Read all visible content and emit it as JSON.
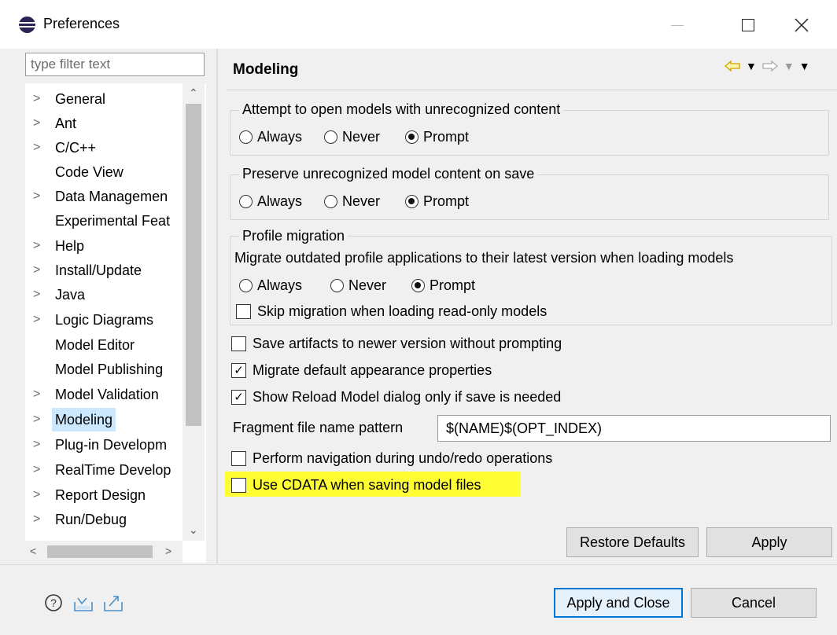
{
  "window": {
    "title": "Preferences",
    "controls": [
      "minimize",
      "maximize",
      "close"
    ]
  },
  "sidebar": {
    "filter_placeholder": "type filter text",
    "items": [
      {
        "label": "General",
        "expandable": true
      },
      {
        "label": "Ant",
        "expandable": true
      },
      {
        "label": "C/C++",
        "expandable": true
      },
      {
        "label": "Code View",
        "expandable": false
      },
      {
        "label": "Data Managemen",
        "expandable": true
      },
      {
        "label": "Experimental Feat",
        "expandable": false
      },
      {
        "label": "Help",
        "expandable": true
      },
      {
        "label": "Install/Update",
        "expandable": true
      },
      {
        "label": "Java",
        "expandable": true
      },
      {
        "label": "Logic Diagrams",
        "expandable": true
      },
      {
        "label": "Model Editor",
        "expandable": false
      },
      {
        "label": "Model Publishing",
        "expandable": false
      },
      {
        "label": "Model Validation",
        "expandable": true
      },
      {
        "label": "Modeling",
        "expandable": true,
        "selected": true
      },
      {
        "label": "Plug-in Developm",
        "expandable": true
      },
      {
        "label": "RealTime Develop",
        "expandable": true
      },
      {
        "label": "Report Design",
        "expandable": true
      },
      {
        "label": "Run/Debug",
        "expandable": true
      }
    ]
  },
  "main": {
    "title": "Modeling",
    "nav_icons": [
      "back-arrow-icon",
      "back-menu-icon",
      "forward-arrow-icon",
      "forward-menu-icon",
      "view-menu-icon"
    ],
    "group_open": {
      "title": "Attempt to open models with unrecognized content",
      "options": [
        "Always",
        "Never",
        "Prompt"
      ],
      "selected": "Prompt"
    },
    "group_preserve": {
      "title": "Preserve unrecognized model content on save",
      "options": [
        "Always",
        "Never",
        "Prompt"
      ],
      "selected": "Prompt"
    },
    "group_profile": {
      "title": "Profile migration",
      "description": "Migrate outdated profile applications to their latest version when loading models",
      "options": [
        "Always",
        "Never",
        "Prompt"
      ],
      "selected": "Prompt",
      "skip_label": "Skip migration when loading read-only models",
      "skip_checked": false
    },
    "checks": [
      {
        "label": "Save artifacts to newer version without prompting",
        "checked": false
      },
      {
        "label": "Migrate default appearance properties",
        "checked": true
      },
      {
        "label": "Show Reload Model dialog only if save is needed",
        "checked": true
      }
    ],
    "fragment": {
      "label": "Fragment file name pattern",
      "value": "$(NAME)$(OPT_INDEX)"
    },
    "checks2": [
      {
        "label": "Perform navigation during undo/redo operations",
        "checked": false
      },
      {
        "label": "Use CDATA when saving model files",
        "checked": false,
        "highlighted": true
      }
    ],
    "restore_label": "Restore Defaults",
    "apply_label": "Apply"
  },
  "footer": {
    "apply_close_label": "Apply and Close",
    "cancel_label": "Cancel",
    "icons": [
      "help-icon",
      "import-icon",
      "export-icon"
    ]
  },
  "colors": {
    "selection": "#cce8ff",
    "highlight": "#ffff33",
    "default_button_border": "#0078d7"
  }
}
